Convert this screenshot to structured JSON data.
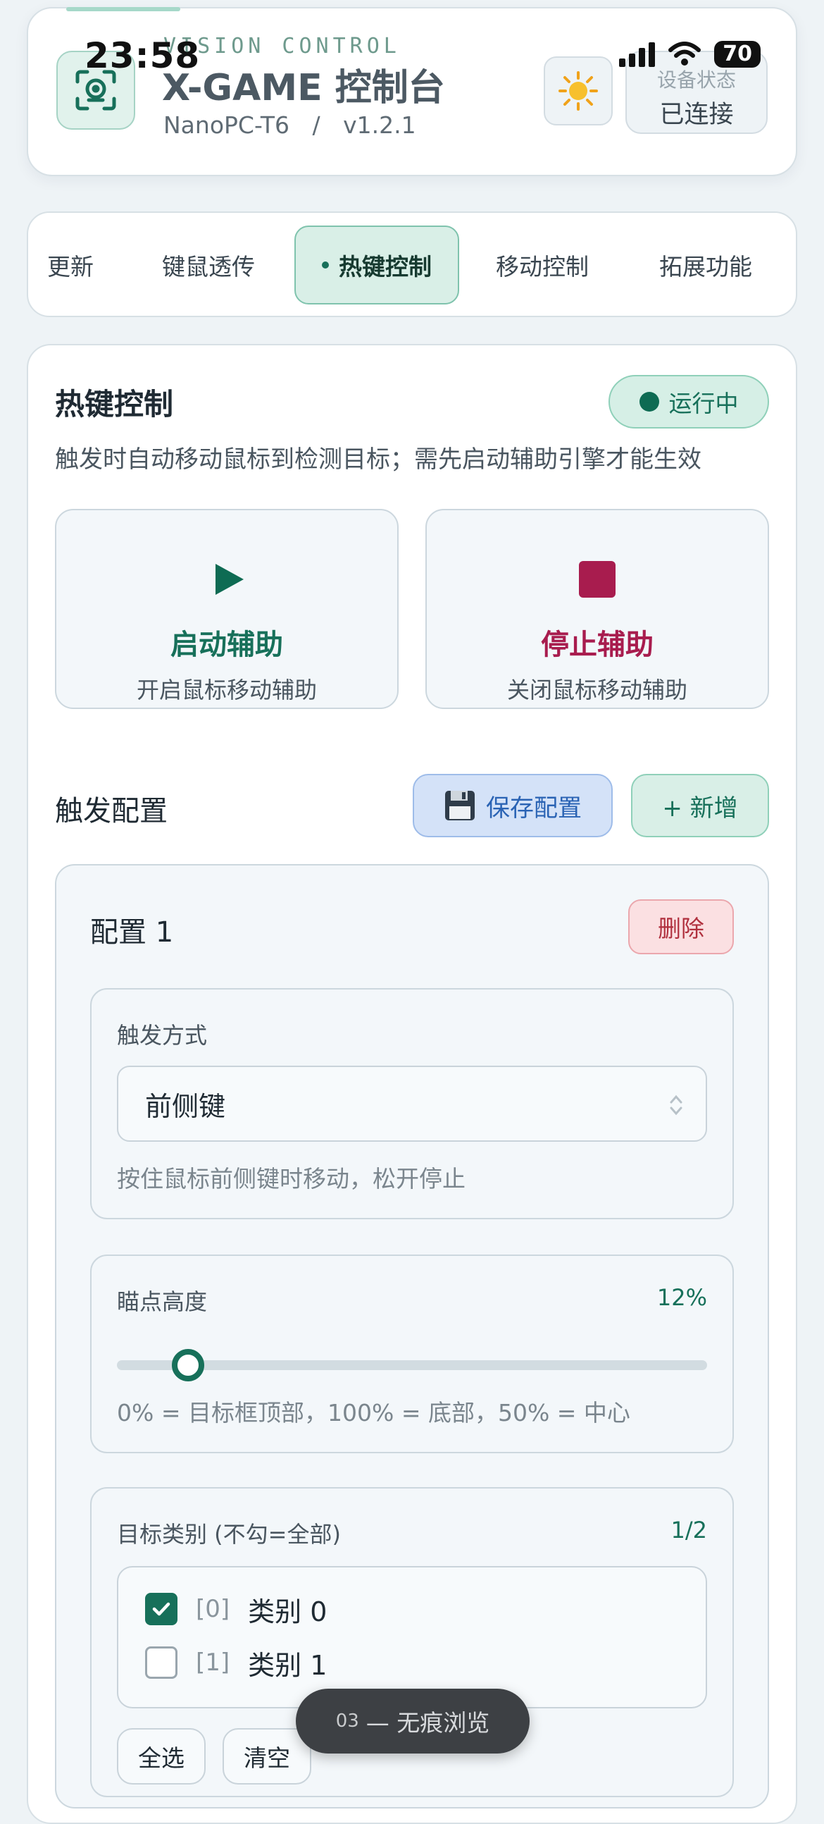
{
  "status_bar": {
    "time": "23:58",
    "battery": "70"
  },
  "header": {
    "kicker": "VISION CONTROL",
    "title": "X-GAME 控制台",
    "device": "NanoPC-T6",
    "separator": "/",
    "version": "v1.2.1",
    "theme_icon": "sun-icon",
    "device_status_label": "设备状态",
    "device_status_value": "已连接"
  },
  "tabs": [
    {
      "label": "更新",
      "active": false
    },
    {
      "label": "键鼠透传",
      "active": false
    },
    {
      "label": "热键控制",
      "active": true
    },
    {
      "label": "移动控制",
      "active": false
    },
    {
      "label": "拓展功能",
      "active": false
    }
  ],
  "hotkey": {
    "title": "热键控制",
    "status_badge": "运行中",
    "description": "触发时自动移动鼠标到检测目标；需先启动辅助引擎才能生效",
    "start": {
      "title": "启动辅助",
      "subtitle": "开启鼠标移动辅助",
      "icon": "play-icon"
    },
    "stop": {
      "title": "停止辅助",
      "subtitle": "关闭鼠标移动辅助",
      "icon": "stop-icon"
    }
  },
  "trigger_config": {
    "title": "触发配置",
    "save_label": "保存配置",
    "save_icon": "floppy-disk-icon",
    "add_label": "+ 新增",
    "configs": [
      {
        "name": "配置 1",
        "delete_label": "删除",
        "trigger_label": "触发方式",
        "trigger_value": "前侧键",
        "trigger_hint": "按住鼠标前侧键时移动，松开停止",
        "aim_label": "瞄点高度",
        "aim_value": "12%",
        "aim_fraction": 0.12,
        "aim_hint": "0% = 目标框顶部，100% = 底部，50% = 中心",
        "target_label": "目标类别 (不勾=全部)",
        "target_count": "1/2",
        "classes": [
          {
            "index": "[0]",
            "name": "类别 0",
            "checked": true
          },
          {
            "index": "[1]",
            "name": "类别 1",
            "checked": false
          }
        ],
        "select_all_label": "全选",
        "clear_label": "清空"
      }
    ]
  },
  "toast": {
    "prefix": "03",
    "text": "— 无痕浏览"
  },
  "colors": {
    "accent": "#17705a",
    "start_green": "#0e6b53",
    "stop_red": "#a81c4e",
    "save_blue": "#2a63b4",
    "danger": "#b0303e"
  }
}
